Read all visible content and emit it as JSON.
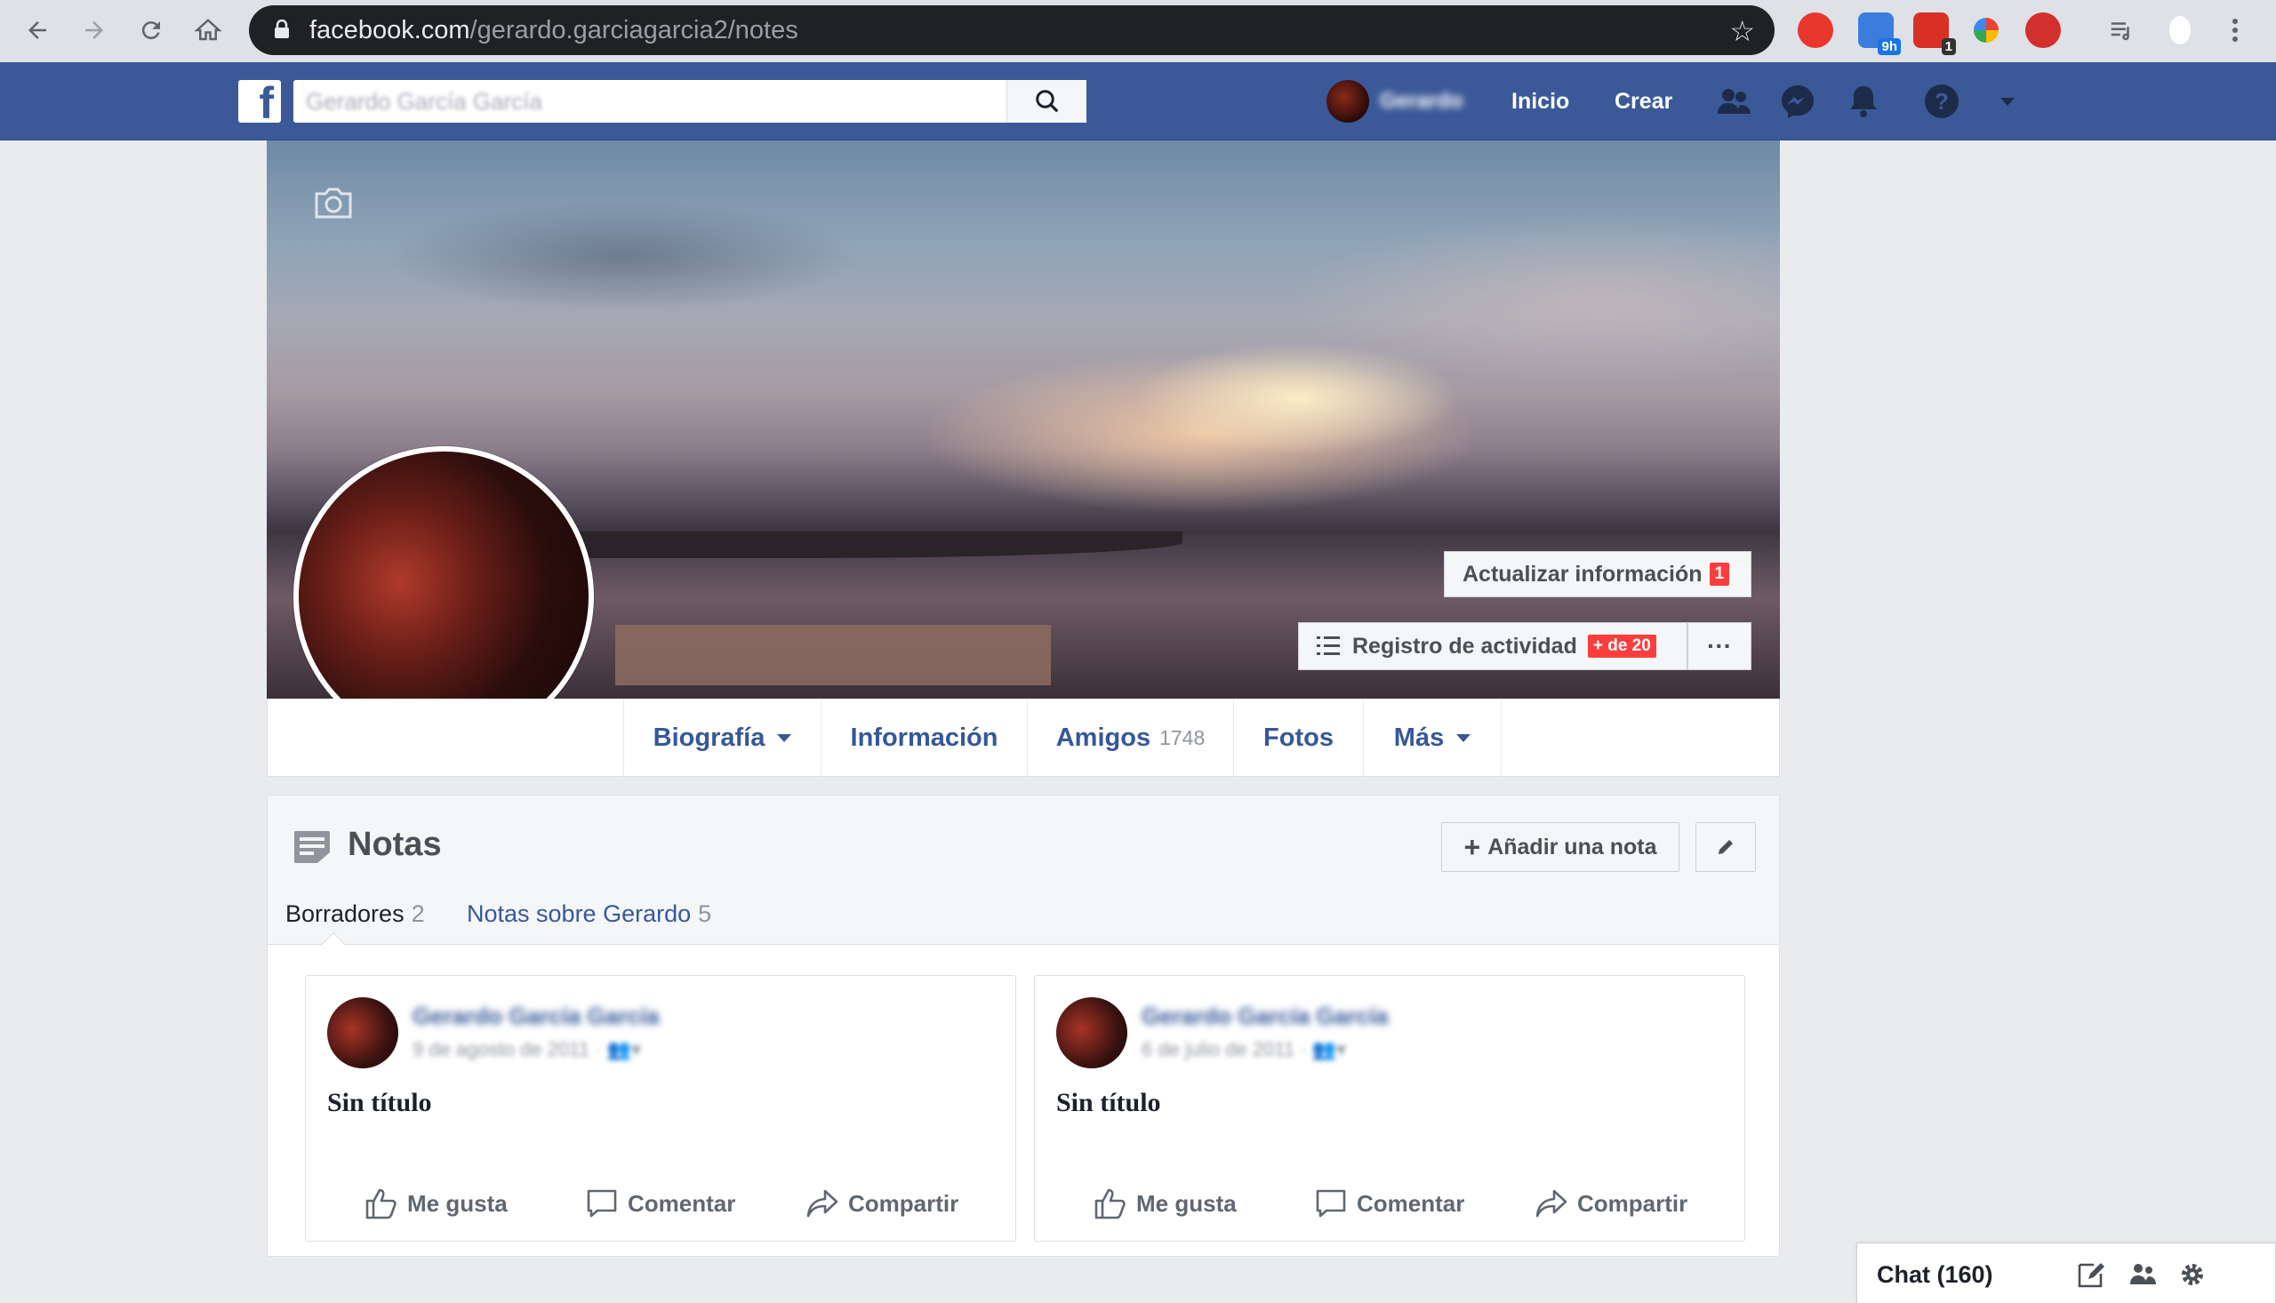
{
  "browser": {
    "url_host": "facebook.com",
    "url_path": "/gerardo.garciagarcia2/notes",
    "ext_badges": [
      "9h",
      "1"
    ]
  },
  "fb_header": {
    "search_value": "Gerardo García García",
    "user_name": "Gerardo",
    "nav_home": "Inicio",
    "nav_create": "Crear"
  },
  "cover": {
    "update_info_label": "Actualizar información",
    "update_info_badge": "1",
    "activity_label": "Registro de actividad",
    "activity_badge": "+ de 20",
    "more_label": "···"
  },
  "profile_tabs": [
    {
      "label": "Biografía"
    },
    {
      "label": "Información"
    },
    {
      "label": "Amigos",
      "count": "1748"
    },
    {
      "label": "Fotos"
    },
    {
      "label": "Más"
    }
  ],
  "notes": {
    "title": "Notas",
    "add_note_label": "Añadir una nota",
    "subtabs": [
      {
        "label": "Borradores",
        "count": "2"
      },
      {
        "label": "Notas sobre Gerardo",
        "count": "5"
      }
    ],
    "cards": [
      {
        "author": "Gerardo García García",
        "date": "9 de agosto de 2011 · ",
        "title": "Sin título"
      },
      {
        "author": "Gerardo García García",
        "date": "6 de julio de 2011 · ",
        "title": "Sin título"
      }
    ],
    "actions": {
      "like": "Me gusta",
      "comment": "Comentar",
      "share": "Compartir"
    }
  },
  "chat": {
    "label": "Chat (160)"
  },
  "colors": {
    "fb_blue": "#3b5998",
    "link_blue": "#365899",
    "badge_red": "#fa3e3e"
  }
}
